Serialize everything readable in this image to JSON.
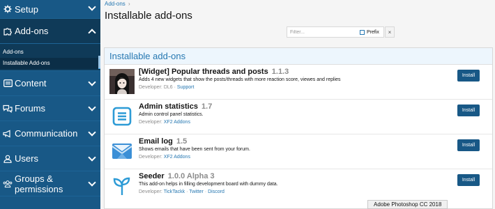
{
  "sidebar": {
    "sections": [
      {
        "label": "Setup",
        "icon": "gear-icon",
        "expanded": false
      },
      {
        "label": "Add-ons",
        "icon": "puzzle-icon",
        "expanded": true
      },
      {
        "label": "Content",
        "icon": "content-icon",
        "expanded": false
      },
      {
        "label": "Forums",
        "icon": "forums-icon",
        "expanded": false
      },
      {
        "label": "Communication",
        "icon": "megaphone-icon",
        "expanded": false
      },
      {
        "label": "Users",
        "icon": "user-icon",
        "expanded": false
      },
      {
        "label": "Groups & permissions",
        "icon": "users-icon",
        "expanded": false
      }
    ],
    "addons_sub": [
      {
        "label": "Add-ons",
        "selected": false
      },
      {
        "label": "Installable Add-ons",
        "selected": true
      }
    ]
  },
  "breadcrumb": {
    "label": "Add-ons",
    "sep": "›"
  },
  "page": {
    "title": "Installable add-ons"
  },
  "filter": {
    "placeholder": "Filter...",
    "prefix_label": "Prefix",
    "clear": "×"
  },
  "block": {
    "title": "Installable add-ons"
  },
  "addons": [
    {
      "title": "[Widget] Popular threads and posts",
      "version": "1.1.3",
      "description": "Adds 4 new widgets that show the posts/threads with more reaction score, viewes and replies",
      "developer_prefix": "Developer:",
      "developer_text": "DL6",
      "links": [
        "Support"
      ],
      "icon": "avatar-image-icon",
      "button": "Install"
    },
    {
      "title": "Admin statistics",
      "version": "1.7",
      "description": "Admin control panel statistics.",
      "developer_prefix": "Developer:",
      "developer_text": "",
      "links": [
        "XF2 Addons"
      ],
      "icon": "list-icon",
      "button": "Install"
    },
    {
      "title": "Email log",
      "version": "1.5",
      "description": "Shows emails that have been sent from your forum.",
      "developer_prefix": "Developer:",
      "developer_text": "",
      "links": [
        "XF2 Addons"
      ],
      "icon": "envelope-icon",
      "button": "Install"
    },
    {
      "title": "Seeder",
      "version": "1.0.0 Alpha 3",
      "description": "This add-on helps in filling development board with dummy data.",
      "developer_prefix": "Developer:",
      "developer_text": "",
      "links": [
        "TickTackk",
        "Twitter",
        "Discord"
      ],
      "icon": "sprout-icon",
      "button": "Install"
    }
  ],
  "tooltip": {
    "text": "Adobe Photoshop CC 2018"
  },
  "colors": {
    "sidebar": "#185886",
    "sidebar_active": "#0f3a58",
    "accent": "#2577b1",
    "button": "#185886"
  }
}
